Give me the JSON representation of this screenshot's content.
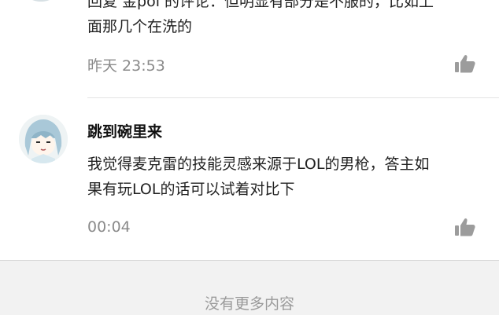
{
  "comments": [
    {
      "text_line1": "回复 金pol 的评论：但明显有部分是不服的，比如上",
      "text_line2": "面那几个在洗的",
      "time": "昨天 23:53"
    },
    {
      "name": "跳到碗里来",
      "text_line1": "我觉得麦克雷的技能灵感来源于LOL的男枪，答主如",
      "text_line2": "果有玩LOL的话可以试着对比下",
      "time": "00:04"
    }
  ],
  "footer": {
    "no_more": "没有更多内容"
  },
  "icons": {
    "like": "thumbs-up-icon",
    "avatar": "anime-avatar"
  },
  "colors": {
    "icon_gray": "#9c9c9c",
    "footer_bg": "#f2f2f2"
  }
}
